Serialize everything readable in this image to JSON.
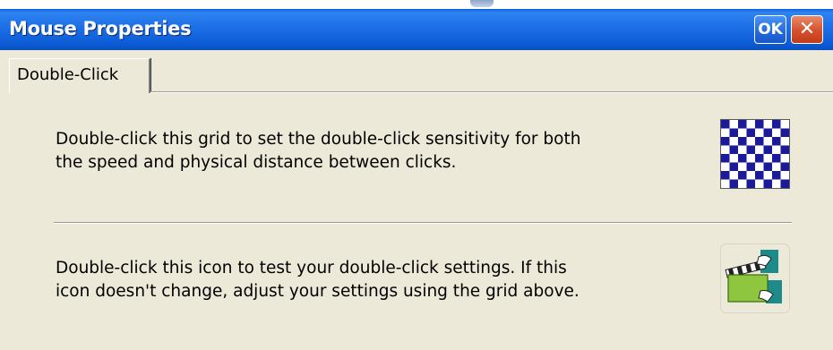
{
  "window": {
    "title": "Mouse Properties",
    "ok_label": "OK",
    "close_label": "✕"
  },
  "tabs": [
    {
      "label": "Double-Click"
    }
  ],
  "grid_section": {
    "line1": "Double-click this grid to set the double-click sensitivity for both",
    "line2": "the speed and physical distance between clicks.",
    "icon": "checkerboard-grid-icon"
  },
  "test_section": {
    "line1": "Double-click this icon to test your double-click settings. If this",
    "line2": "icon doesn't change, adjust your settings using the grid above.",
    "icon": "clapperboard-test-icon"
  },
  "colors": {
    "titlebar": "#0a5fdc",
    "grid_dark": "#1a1a9a",
    "grid_light": "#ffffff",
    "close_button": "#d6502c",
    "window_background": "#ece9d8"
  }
}
